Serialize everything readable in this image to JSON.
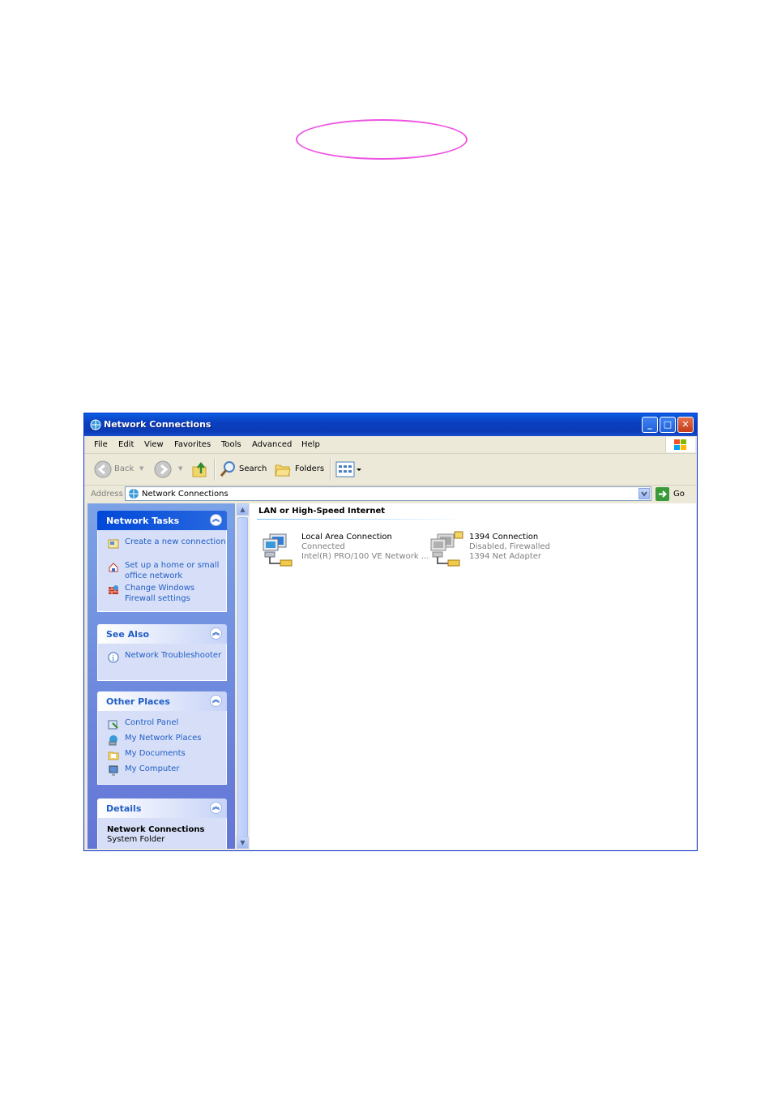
{
  "window": {
    "title": "Network Connections",
    "title_icon": "network-connections-icon"
  },
  "menu": {
    "items": [
      "File",
      "Edit",
      "View",
      "Favorites",
      "Tools",
      "Advanced",
      "Help"
    ]
  },
  "toolbar": {
    "back_label": "Back",
    "search_label": "Search",
    "folders_label": "Folders"
  },
  "address": {
    "label": "Address",
    "value": "Network Connections",
    "go_label": "Go"
  },
  "tasks": {
    "network_tasks": {
      "title": "Network Tasks",
      "items": [
        {
          "label": "Create a new connection",
          "icon": "new-connection-icon"
        },
        {
          "label": "Set up a home or small office network",
          "icon": "home-network-icon"
        },
        {
          "label": "Change Windows Firewall settings",
          "icon": "firewall-icon"
        }
      ]
    },
    "see_also": {
      "title": "See Also",
      "items": [
        {
          "label": "Network Troubleshooter",
          "icon": "info-icon"
        }
      ]
    },
    "other_places": {
      "title": "Other Places",
      "items": [
        {
          "label": "Control Panel",
          "icon": "control-panel-icon"
        },
        {
          "label": "My Network Places",
          "icon": "network-places-icon"
        },
        {
          "label": "My Documents",
          "icon": "documents-icon"
        },
        {
          "label": "My Computer",
          "icon": "computer-icon"
        }
      ]
    },
    "details": {
      "title": "Details",
      "name": "Network Connections",
      "type": "System Folder"
    }
  },
  "content": {
    "group_header": "LAN or High-Speed Internet",
    "connections": [
      {
        "name": "Local Area Connection",
        "status": "Connected",
        "device": "Intel(R) PRO/100 VE Network ...",
        "icon": "lan-connection-icon"
      },
      {
        "name": "1394 Connection",
        "status": "Disabled, Firewalled",
        "device": "1394 Net Adapter",
        "icon": "disabled-connection-icon"
      }
    ]
  },
  "colors": {
    "titlebar": "#0a3fbf",
    "task_link": "#215dc6",
    "highlight_ellipse": "#ee55e2"
  }
}
